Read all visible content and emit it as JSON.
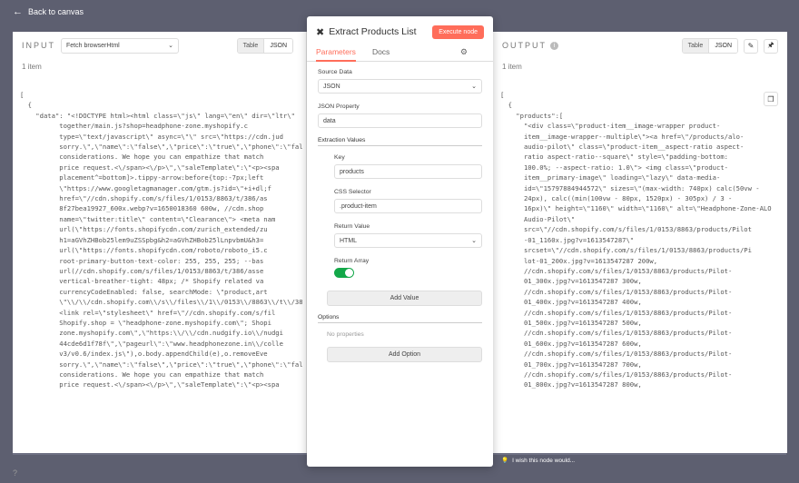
{
  "topbar": {
    "back_label": "Back to canvas"
  },
  "input_panel": {
    "title": "INPUT",
    "source_select": "Fetch browserHtml",
    "view_tabs": [
      "Table",
      "JSON"
    ],
    "active_view": "JSON",
    "count": "1 item",
    "json_lines": [
      "[",
      "  {",
      "    \"data\": \"<!DOCTYPE html><html class=\\\"js\\\" lang=\\\"en\\\" dir=\\\"ltr\\\"",
      "          together/main.js?shop=headphone-zone.myshopify.c",
      "          type=\\\"text/javascript\\\" async=\\\"\\\" src=\\\"https://cdn.jud",
      "          sorry.\\\",\\\"name\\\":\\\"false\\\",\\\"price\\\":\\\"true\\\",\\\"phone\\\":\\\"false",
      "          considerations. We hope you can empathize that match",
      "          price request.<\\/span><\\/p>\\\",\\\"saleTemplate\\\":\\\"<p><spa",
      "          placement^=bottom]>.tippy-arrow:before{top:-7px;left",
      "          \\\"https://www.googletagmanager.com/gtm.js?id=\\\"+i+dl;f",
      "          href=\\\"//cdn.shopify.com/s/files/1/0153/8863/t/386/as",
      "          8f27bea19927_600x.webp?v=1650018360 600w, //cdn.shop",
      "          name=\\\"twitter:title\\\" content=\\\"Clearance\\\"> <meta nam",
      "          url(\\\"https://fonts.shopifycdn.com/zurich_extended/zu",
      "          h1=aGVhZHBob25lem9uZSSpbg&h2=aGVhZHBob25lLnpvbmU&h3=",
      "          url(\\\"https://fonts.shopifycdn.com/roboto/roboto_i5.c",
      "          root-primary-button-text-color: 255, 255, 255; --bas",
      "          url(//cdn.shopify.com/s/files/1/0153/8863/t/386/asse",
      "          vertical-breather-tight: 48px; /* Shopify related va",
      "          currencyCodeEnabled: false, searchMode: \\\"product,art",
      "          \\\"\\\\/\\\\/cdn.shopify.com\\\\/s\\\\/files\\\\/1\\\\/0153\\\\/8863\\\\/t\\\\/38",
      "          <link rel=\\\"stylesheet\\\" href=\\\"//cdn.shopify.com/s/fil",
      "          Shopify.shop = \\\"headphone-zone.myshopify.com\\\"; Shopi",
      "          zone.myshopify.com\\\",\\\"https:\\\\/\\\\/cdn.nudgify.io\\\\/nudgi",
      "          44cde6d1f78f\\\",\\\"pageurl\\\":\\\"www.headphonezone.in\\\\/colle",
      "          v3/v0.6/index.js\\\"),o.body.appendChild(e),o.removeEve",
      "          sorry.\\\",\\\"name\\\":\\\"false\\\",\\\"price\\\":\\\"true\\\",\\\"phone\\\":\\\"false",
      "          considerations. We hope you can empathize that match",
      "          price request.<\\/span><\\/p>\\\",\\\"saleTemplate\\\":\\\"<p><spa"
    ]
  },
  "modal": {
    "title": "Extract Products List",
    "execute_label": "Execute node",
    "tabs": [
      "Parameters",
      "Docs"
    ],
    "active_tab": "Parameters",
    "source_data_label": "Source Data",
    "source_data_value": "JSON",
    "json_property_label": "JSON Property",
    "json_property_value": "data",
    "extraction_values_label": "Extraction Values",
    "key_label": "Key",
    "key_value": "products",
    "css_selector_label": "CSS Selector",
    "css_selector_value": ".product-item",
    "return_value_label": "Return Value",
    "return_value_value": "HTML",
    "return_array_label": "Return Array",
    "return_array_on": true,
    "add_value_label": "Add Value",
    "options_label": "Options",
    "no_properties_label": "No properties",
    "add_option_label": "Add Option"
  },
  "output_panel": {
    "title": "OUTPUT",
    "view_tabs": [
      "Table",
      "JSON"
    ],
    "active_view": "JSON",
    "count": "1 item",
    "json_lines": [
      "[",
      "  {",
      "    \"products\":[",
      "      \"<div class=\\\"product-item__image-wrapper product-",
      "      item__image-wrapper--multiple\\\"><a href=\\\"/products/alo-",
      "      audio-pilot\\\" class=\\\"product-item__aspect-ratio aspect-",
      "      ratio aspect-ratio--square\\\" style=\\\"padding-bottom:",
      "      100.0%; --aspect-ratio: 1.0\\\"> <img class=\\\"product-",
      "      item__primary-image\\\" loading=\\\"lazy\\\" data-media-",
      "      id=\\\"15797884944572\\\" sizes=\\\"(max-width: 740px) calc(50vw -",
      "      24px), calc((min(100vw - 80px, 1520px) - 305px) / 3 -",
      "      16px)\\\" height=\\\"1160\\\" width=\\\"1160\\\" alt=\\\"Headphone-Zone-ALO",
      "      Audio-Pilot\\\"",
      "      src=\\\"//cdn.shopify.com/s/files/1/0153/8863/products/Pilot",
      "      -01_1160x.jpg?v=1613547287\\\"",
      "      srcset=\\\"//cdn.shopify.com/s/files/1/0153/8863/products/Pi",
      "      lot-01_200x.jpg?v=1613547287 200w,",
      "      //cdn.shopify.com/s/files/1/0153/8863/products/Pilot-",
      "      01_300x.jpg?v=1613547287 300w,",
      "      //cdn.shopify.com/s/files/1/0153/8863/products/Pilot-",
      "      01_400x.jpg?v=1613547287 400w,",
      "      //cdn.shopify.com/s/files/1/0153/8863/products/Pilot-",
      "      01_500x.jpg?v=1613547287 500w,",
      "      //cdn.shopify.com/s/files/1/0153/8863/products/Pilot-",
      "      01_600x.jpg?v=1613547287 600w,",
      "      //cdn.shopify.com/s/files/1/0153/8863/products/Pilot-",
      "      01_700x.jpg?v=1613547287 700w,",
      "      //cdn.shopify.com/s/files/1/0153/8863/products/Pilot-",
      "      01_800x.jpg?v=1613547287 800w,"
    ]
  },
  "footer": {
    "wish_label": "I wish this node would...",
    "help_label": "?"
  },
  "colors": {
    "accent": "#ff6d5a",
    "toggle_on": "#13a849",
    "backdrop": "#5d5f70"
  }
}
